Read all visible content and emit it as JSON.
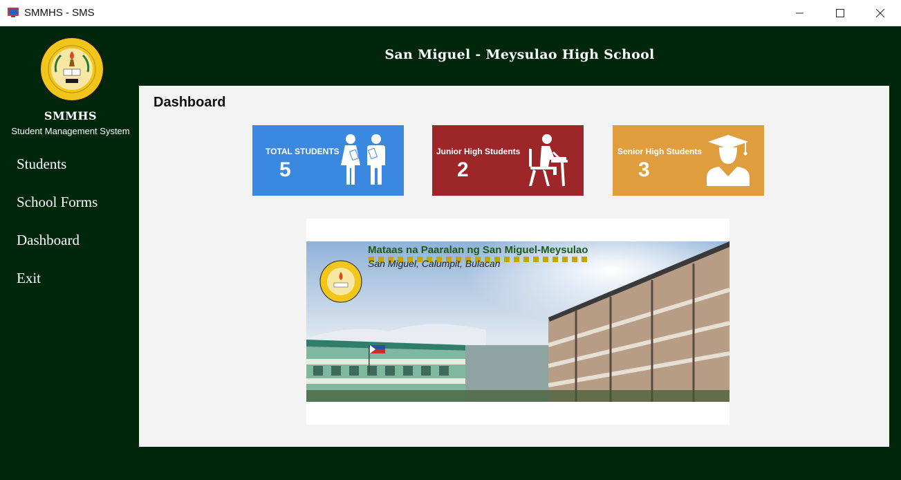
{
  "window": {
    "title": "SMMHS - SMS"
  },
  "sidebar": {
    "brand": "SMMHS",
    "subtitle": "Student Management System",
    "items": [
      {
        "label": "Students"
      },
      {
        "label": "School Forms"
      },
      {
        "label": "Dashboard"
      },
      {
        "label": "Exit"
      }
    ]
  },
  "header": {
    "title": "San Miguel - Meysulao High School"
  },
  "dashboard": {
    "title": "Dashboard",
    "cards": [
      {
        "label": "TOTAL STUDENTS",
        "count": "5",
        "color": "#3b88e0",
        "icon": "students-icon"
      },
      {
        "label": "Junior High Students",
        "count": "2",
        "color": "#9c2628",
        "icon": "student-desk-icon"
      },
      {
        "label": "Senior High Students",
        "count": "3",
        "color": "#e09d3e",
        "icon": "graduate-icon"
      }
    ],
    "banner": {
      "line1": "Mataas na Paaralan ng San Miguel-Meysulao",
      "line2": "San Miguel, Calumpit, Bulacan"
    }
  },
  "colors": {
    "app_bg": "#00270b",
    "panel_bg": "#f3f3f3"
  }
}
